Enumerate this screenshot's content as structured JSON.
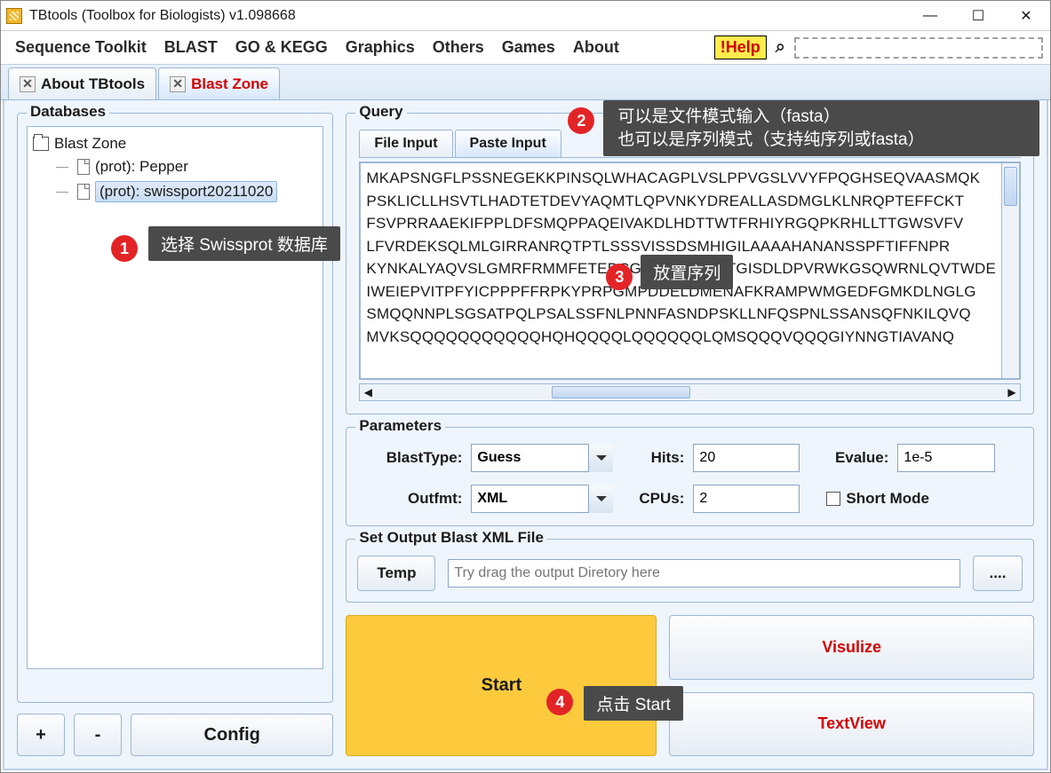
{
  "window": {
    "title": "TBtools (Toolbox for Biologists) v1.098668"
  },
  "menubar": {
    "items": [
      "Sequence Toolkit",
      "BLAST",
      "GO & KEGG",
      "Graphics",
      "Others",
      "Games",
      "About"
    ],
    "help": "!Help"
  },
  "tabs": [
    {
      "label": "About TBtools",
      "active": false
    },
    {
      "label": "Blast Zone",
      "active": true
    }
  ],
  "databases": {
    "title": "Databases",
    "root": "Blast Zone",
    "items": [
      {
        "label": "(prot): Pepper",
        "selected": false
      },
      {
        "label": "(prot): swissport20211020",
        "selected": true
      }
    ],
    "buttons": {
      "add": "+",
      "remove": "-",
      "config": "Config"
    }
  },
  "query": {
    "title": "Query",
    "tabs": [
      "File Input",
      "Paste Input"
    ],
    "active_tab": "Paste Input",
    "sequence": "MKAPSNGFLPSSNEGEKKPINSQLWHACAGPLVSLPPVGSLVVYFPQGHSEQVAASMQK\nPSKLICLLHSVTLHADTETDEVYAQMTLQPVNKYDREALLASDMGLKLNRQPTEFFCKT\nFSVPRRAAEKIFPPLDFSMQPPAQEIVAKDLHDTTWTFRHIYRGQPKRHLLTTGWSVFV\nLFVRDEKSQLMLGIRRANRQTPTLSSSVISSDSMHIGILAAAAHANANSSPFTIFFNPR\nKYNKALYAQVSLGMRFRMMFETEDCGLRRYMGTVTGISDLDPVRWKGSQWRNLQVTWDE\nIWEIEPVITPFYICPPPFFRPKYPRPGMPDDELDMENAFKRAMPWMGEDFGMKDLNGLG\nSMQQNNPLSGSATPQLPSALSSFNLPNNFASNDPSKLLNFQSPNLSSANSQFNKILQVQ\nMVKSQQQQQQQQQQQHQHQQQQLQQQQQQLQMSQQQVQQQGIYNNGTIAVANQ"
  },
  "parameters": {
    "title": "Parameters",
    "blasttype_label": "BlastType:",
    "blasttype": "Guess",
    "hits_label": "Hits:",
    "hits": "20",
    "evalue_label": "Evalue:",
    "evalue": "1e-5",
    "outfmt_label": "Outfmt:",
    "outfmt": "XML",
    "cpus_label": "CPUs:",
    "cpus": "2",
    "shortmode_label": "Short Mode"
  },
  "output": {
    "title": "Set Output Blast XML File",
    "temp_btn": "Temp",
    "placeholder": "Try drag the output Diretory here",
    "browse": "...."
  },
  "actions": {
    "start": "Start",
    "visualize": "Visulize",
    "textview": "TextView"
  },
  "annotations": {
    "a1": "选择 Swissprot 数据库",
    "a2_line1": "可以是文件模式输入（fasta）",
    "a2_line2": "也可以是序列模式（支持纯序列或fasta）",
    "a3": "放置序列",
    "a4": "点击 Start"
  }
}
